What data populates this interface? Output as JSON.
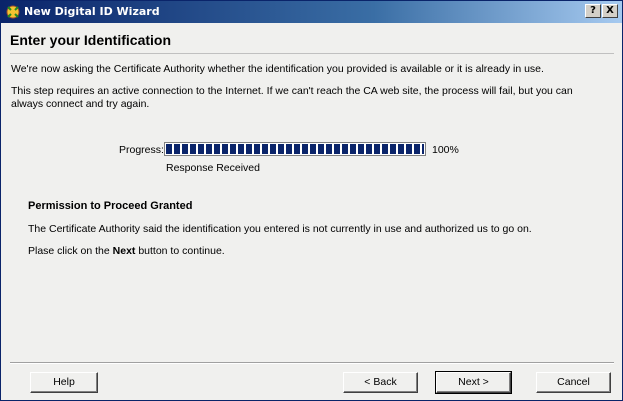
{
  "window": {
    "title": "New Digital ID Wizard",
    "help_button": "?",
    "close_button": "X"
  },
  "header": {
    "title": "Enter your Identification"
  },
  "body": {
    "paragraph1": "We're now asking the Certificate Authority whether the identification you provided is available or it is already in use.",
    "paragraph2_line1": "This step requires an active connection to the Internet. If we can't reach the CA web site, the process will fail, but you can",
    "paragraph2_line2": "always connect and try again."
  },
  "progress": {
    "label": "Progress:",
    "value": 1.0,
    "percent_text": "100%",
    "status": "Response Received"
  },
  "permission": {
    "title": "Permission to Proceed Granted",
    "message": "The Certificate Authority said the identification you entered is not currently in use and authorized us to go on.",
    "instruction_prefix": "Plase click on the ",
    "instruction_bold": "Next",
    "instruction_suffix": " button to continue."
  },
  "buttons": {
    "help": "Help",
    "back": "< Back",
    "next": "Next >",
    "cancel": "Cancel"
  },
  "colors": {
    "titlebar": "#0a246a",
    "progress_fill": "#0a246a",
    "dialog_bg": "#f0f0ee"
  }
}
